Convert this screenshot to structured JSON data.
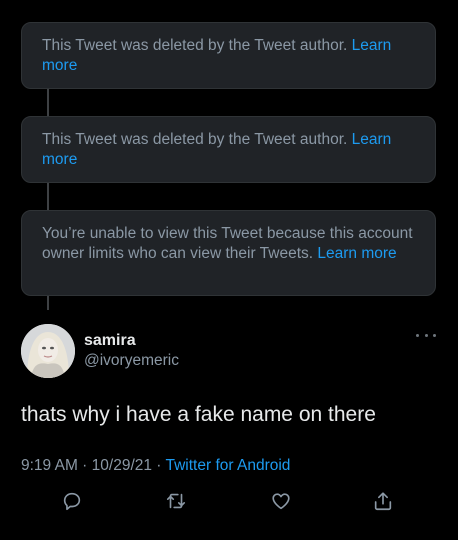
{
  "thread": {
    "notices": [
      {
        "text": "This Tweet was deleted by the Tweet author. ",
        "link": "Learn more"
      },
      {
        "text": "This Tweet was deleted by the Tweet author. ",
        "link": "Learn more"
      },
      {
        "text": "You’re unable to view this Tweet because this account owner limits who can view their Tweets. ",
        "link": "Learn more"
      }
    ]
  },
  "tweet": {
    "display_name": "samira",
    "handle": "@ivoryemeric",
    "text": "thats why i have a fake name on there",
    "time": "9:19 AM",
    "date": "10/29/21",
    "separator": " · ",
    "source": "Twitter for Android",
    "actions": [
      "reply-icon",
      "retweet-icon",
      "like-icon",
      "share-icon"
    ]
  },
  "colors": {
    "background": "#000000",
    "card": "#202327",
    "muted": "#8b98a5",
    "link": "#1d9bf0",
    "text": "#e7e9ea"
  }
}
